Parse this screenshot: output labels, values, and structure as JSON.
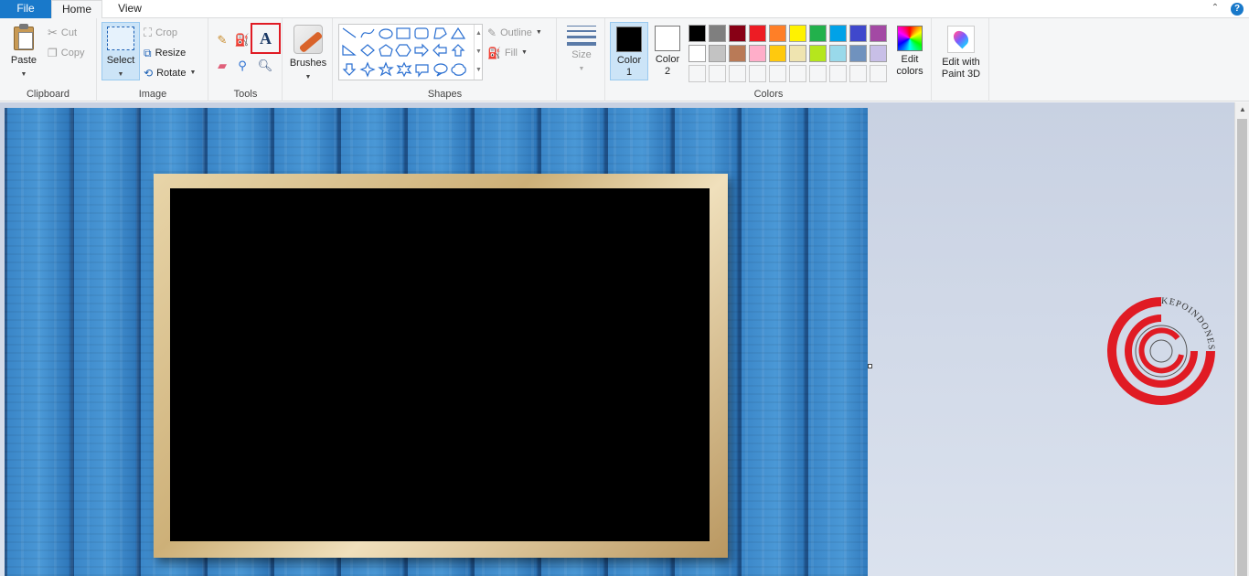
{
  "tabs": {
    "file": "File",
    "home": "Home",
    "view": "View"
  },
  "help_glyph": "?",
  "collapse_glyph": "⌃",
  "clipboard": {
    "label": "Clipboard",
    "paste": "Paste",
    "cut": "Cut",
    "copy": "Copy"
  },
  "image": {
    "label": "Image",
    "select": "Select",
    "crop": "Crop",
    "resize": "Resize",
    "rotate": "Rotate"
  },
  "tools": {
    "label": "Tools",
    "text_glyph": "A"
  },
  "brushes": {
    "label": "Brushes"
  },
  "shapes": {
    "label": "Shapes",
    "outline": "Outline",
    "fill": "Fill"
  },
  "size": {
    "label": "Size"
  },
  "colors": {
    "label": "Colors",
    "color1_line1": "Color",
    "color1_line2": "1",
    "color1_value": "#000000",
    "color2_line1": "Color",
    "color2_line2": "2",
    "color2_value": "#ffffff",
    "edit_line1": "Edit",
    "edit_line2": "colors",
    "palette": [
      [
        "#000000",
        "#7f7f7f",
        "#880015",
        "#ed1c24",
        "#ff7f27",
        "#fff200",
        "#22b14c",
        "#00a2e8",
        "#3f48cc",
        "#a349a4"
      ],
      [
        "#ffffff",
        "#c3c3c3",
        "#b97a57",
        "#ffaec9",
        "#ffc90e",
        "#efe4b0",
        "#b5e61d",
        "#99d9ea",
        "#7092be",
        "#c8bfe7"
      ]
    ]
  },
  "paint3d": {
    "line1": "Edit with",
    "line2": "Paint 3D"
  },
  "accent": "#1979ca",
  "highlight": "#e01b24",
  "watermark_text": "KEPOINDONESIA"
}
